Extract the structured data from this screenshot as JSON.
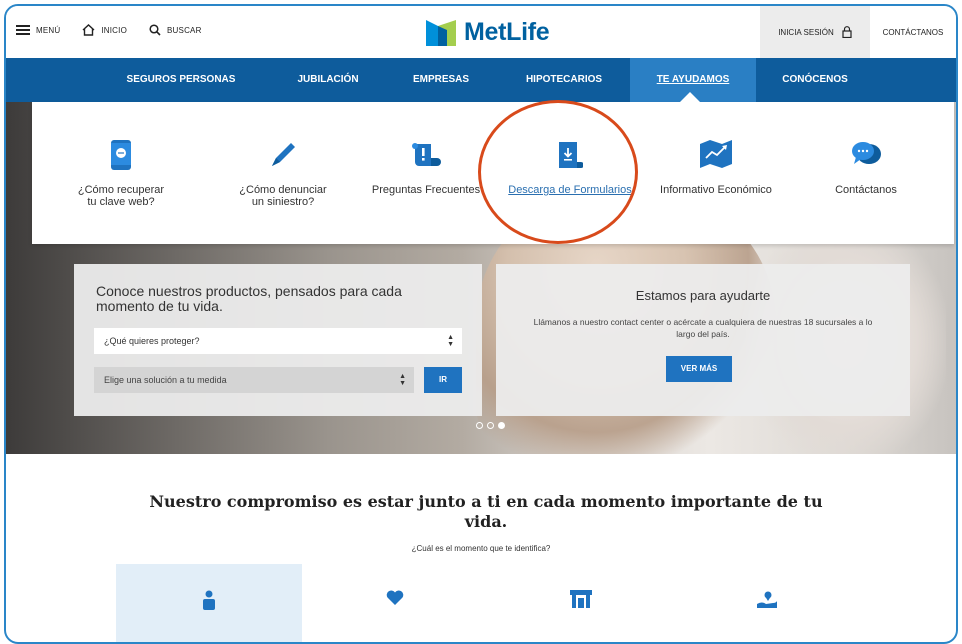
{
  "topbar": {
    "menu_label": "MENÚ",
    "home_label": "INICIO",
    "search_label": "BUSCAR",
    "logo_text": "MetLife",
    "login_label": "INICIA SESIÓN",
    "contact_label": "CONTÁCTANOS"
  },
  "nav": {
    "items": [
      {
        "label": "SEGUROS PERSONAS"
      },
      {
        "label": "JUBILACIÓN"
      },
      {
        "label": "EMPRESAS"
      },
      {
        "label": "HIPOTECARIOS"
      },
      {
        "label": "TE AYUDAMOS",
        "active": true
      },
      {
        "label": "CONÓCENOS"
      }
    ]
  },
  "mega_menu": {
    "items": [
      {
        "label_line1": "¿Cómo recuperar",
        "label_line2": "tu clave web?",
        "icon": "phone-chat-icon"
      },
      {
        "label_line1": "¿Cómo denunciar",
        "label_line2": "un siniestro?",
        "icon": "pencil-icon"
      },
      {
        "label_line1": "Preguntas Frecuentes",
        "label_line2": "",
        "icon": "scroll-exclamation-icon"
      },
      {
        "label_line1": "Descarga de Formularios",
        "label_line2": "",
        "icon": "download-document-icon",
        "highlighted": true
      },
      {
        "label_line1": "Informativo Económico",
        "label_line2": "",
        "icon": "chart-map-icon"
      },
      {
        "label_line1": "Contáctanos",
        "label_line2": "",
        "icon": "chat-bubbles-icon"
      }
    ]
  },
  "products_card": {
    "title": "Conoce nuestros productos, pensados para cada momento de tu vida.",
    "select_protect": "¿Qué quieres proteger?",
    "select_solution": "Elige una solución a tu medida",
    "go_label": "IR"
  },
  "help_card": {
    "title": "Estamos para ayudarte",
    "body": "Llámanos a nuestro contact center o acércate a cualquiera de nuestras 18 sucursales a lo largo del país.",
    "button_label": "VER MÁS"
  },
  "carousel": {
    "total": 3,
    "active_index": 2
  },
  "commitment": {
    "headline": "Nuestro compromiso es estar junto a ti en cada momento importante de tu vida.",
    "question": "¿Cuál es el momento que te identifica?"
  },
  "colors": {
    "brand_blue": "#0061a0",
    "nav_blue": "#0e5c9c",
    "accent_blue": "#1f73c0",
    "annotation_red": "#d84a1b"
  }
}
